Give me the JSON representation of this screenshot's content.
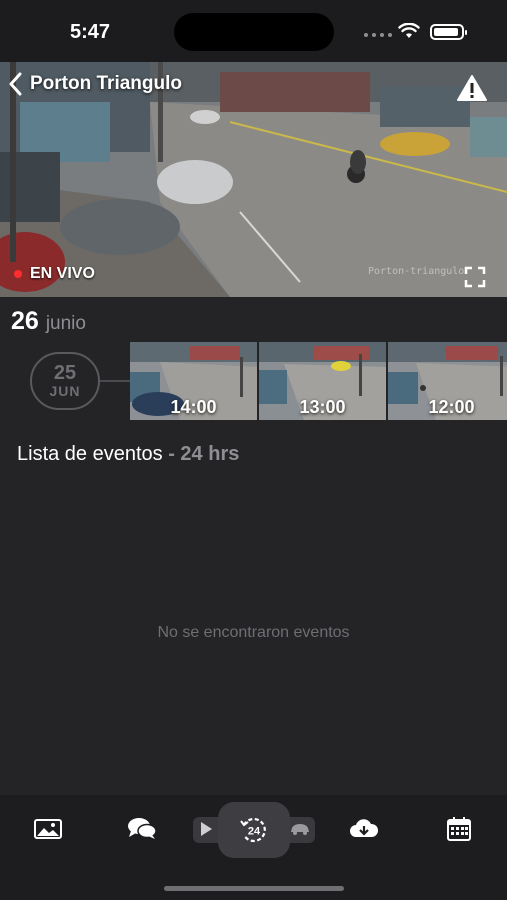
{
  "status_bar": {
    "time": "5:47"
  },
  "camera": {
    "title": "Porton Triangulo",
    "live_label": "EN VIVO",
    "watermark": "Porton-triangulo"
  },
  "date": {
    "day": "26",
    "month": "junio"
  },
  "previous_day": {
    "day": "25",
    "month": "JUN"
  },
  "thumbnails": [
    {
      "time": "14:00"
    },
    {
      "time": "13:00"
    },
    {
      "time": "12:00"
    }
  ],
  "events": {
    "title": "Lista de eventos",
    "range": "- 24 hrs",
    "empty_message": "No se encontraron eventos"
  },
  "tabs": [
    {
      "icon": "gallery-icon"
    },
    {
      "icon": "chat-icon"
    },
    {
      "icon": "play-icon"
    },
    {
      "icon": "24-hours-icon"
    },
    {
      "icon": "car-icon"
    },
    {
      "icon": "cloud-download-icon"
    },
    {
      "icon": "calendar-icon"
    }
  ],
  "colors": {
    "background": "#242427",
    "live_dot": "#ff2d2d",
    "muted_text": "#8e8e93"
  }
}
